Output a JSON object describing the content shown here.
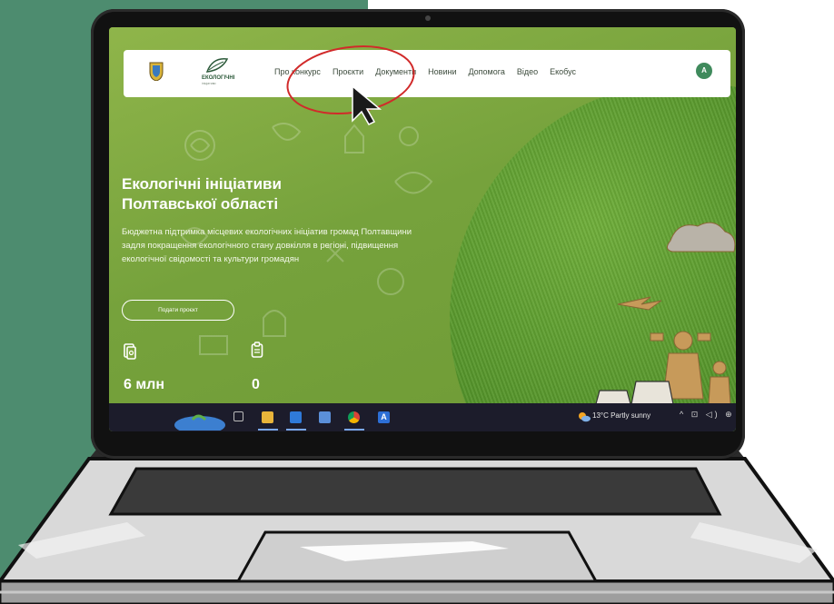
{
  "nav": {
    "brand_name": "ЕКОЛОГІЧНІ",
    "brand_sub": "ініціативи",
    "menu": [
      "Про конкурс",
      "Проєкти",
      "Документи",
      "Новини",
      "Допомога",
      "Відео",
      "Екобус"
    ],
    "avatar_letter": "А"
  },
  "hero": {
    "title_line1": "Екологічні ініціативи",
    "title_line2": "Полтавської області",
    "description": "Бюджетна підтримка місцевих екологічних ініціатив громад Полтавщини задля покращення екологічного стану довкілля в регіоні, підвищення екологічної свідомості та культури громадян",
    "cta_label": "Подати проєкт"
  },
  "stats": [
    {
      "icon": "money-icon",
      "value": "6 млн"
    },
    {
      "icon": "clipboard-icon",
      "value": "0"
    }
  ],
  "taskbar": {
    "icons": [
      "task-view-icon",
      "file-explorer-icon",
      "mail-icon",
      "calculator-icon",
      "chrome-icon",
      "text-editor-icon"
    ],
    "weather": "13°C  Partly sunny",
    "tray": "^ ⊡ ◁) ⊕"
  },
  "colors": {
    "background_left": "#4d8c6f",
    "hero_green": "#7fa73f",
    "grass_green": "#4e8e27",
    "avatar": "#3f8a5c",
    "annotation_red": "#d12a2a"
  }
}
